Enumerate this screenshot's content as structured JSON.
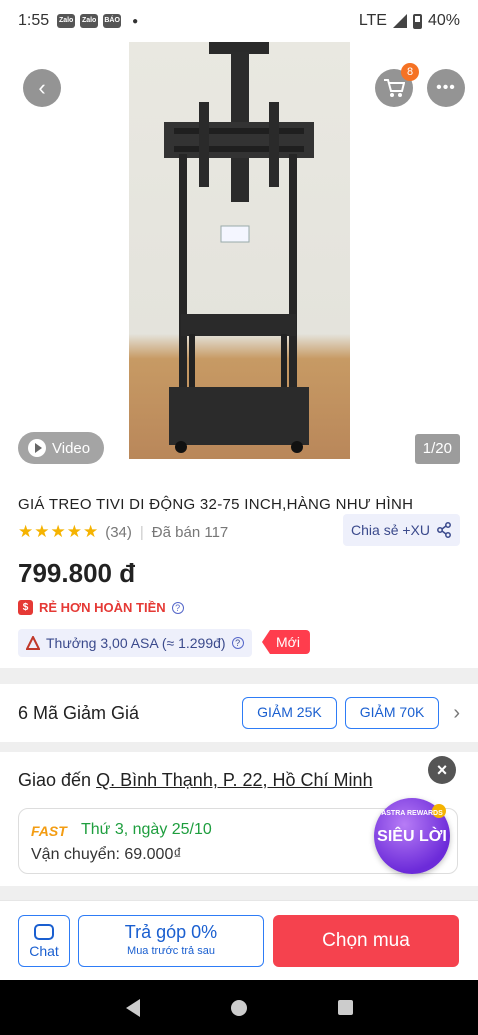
{
  "status_bar": {
    "time": "1:55",
    "notif_icons": [
      "Zalo",
      "Zalo",
      "BÁO MỚI"
    ],
    "network": "LTE",
    "battery": "40%"
  },
  "hero": {
    "cart_count": "8",
    "video_label": "Video",
    "image_counter": "1/20",
    "icons": [
      "back-arrow-icon",
      "cart-icon",
      "more-icon",
      "play-icon"
    ]
  },
  "product": {
    "title": "GIÁ TREO TIVI DI ĐỘNG 32-75 INCH,HÀNG NHƯ HÌNH",
    "stars": "★★★★★",
    "rating": 5,
    "reviews": "(34)",
    "sold": "Đã bán 117",
    "share_label": "Chia sẻ +XU",
    "price": "799.800 đ",
    "cheaper_label": "RẺ HƠN HOÀN TIỀN",
    "reward_label": "Thưởng 3,00 ASA (≈ 1.299đ)",
    "new_tag": "Mới"
  },
  "vouchers": {
    "label": "6 Mã Giảm Giá",
    "chips": [
      "GIẢM 25K",
      "GIẢM 70K"
    ]
  },
  "delivery": {
    "prefix": "Giao đến",
    "address": "Q. Bình Thạnh, P. 22, Hồ Chí Minh",
    "fast_label": "FAST",
    "date": "Thứ 3, ngày 25/10",
    "fee": "Vận chuyển: 69.000₫",
    "astra_small": "ASTRA REWARDS",
    "astra_big": "SIÊU LỜI"
  },
  "bottom_bar": {
    "chat_label": "Chat",
    "installment_title": "Trả góp 0%",
    "installment_sub": "Mua trước trả sau",
    "buy_label": "Chọn mua"
  },
  "colors": {
    "primary_blue": "#1a5fd0",
    "buy_red": "#f5424e",
    "star_yellow": "#f5b301",
    "fast_green": "#1e9e3e"
  }
}
